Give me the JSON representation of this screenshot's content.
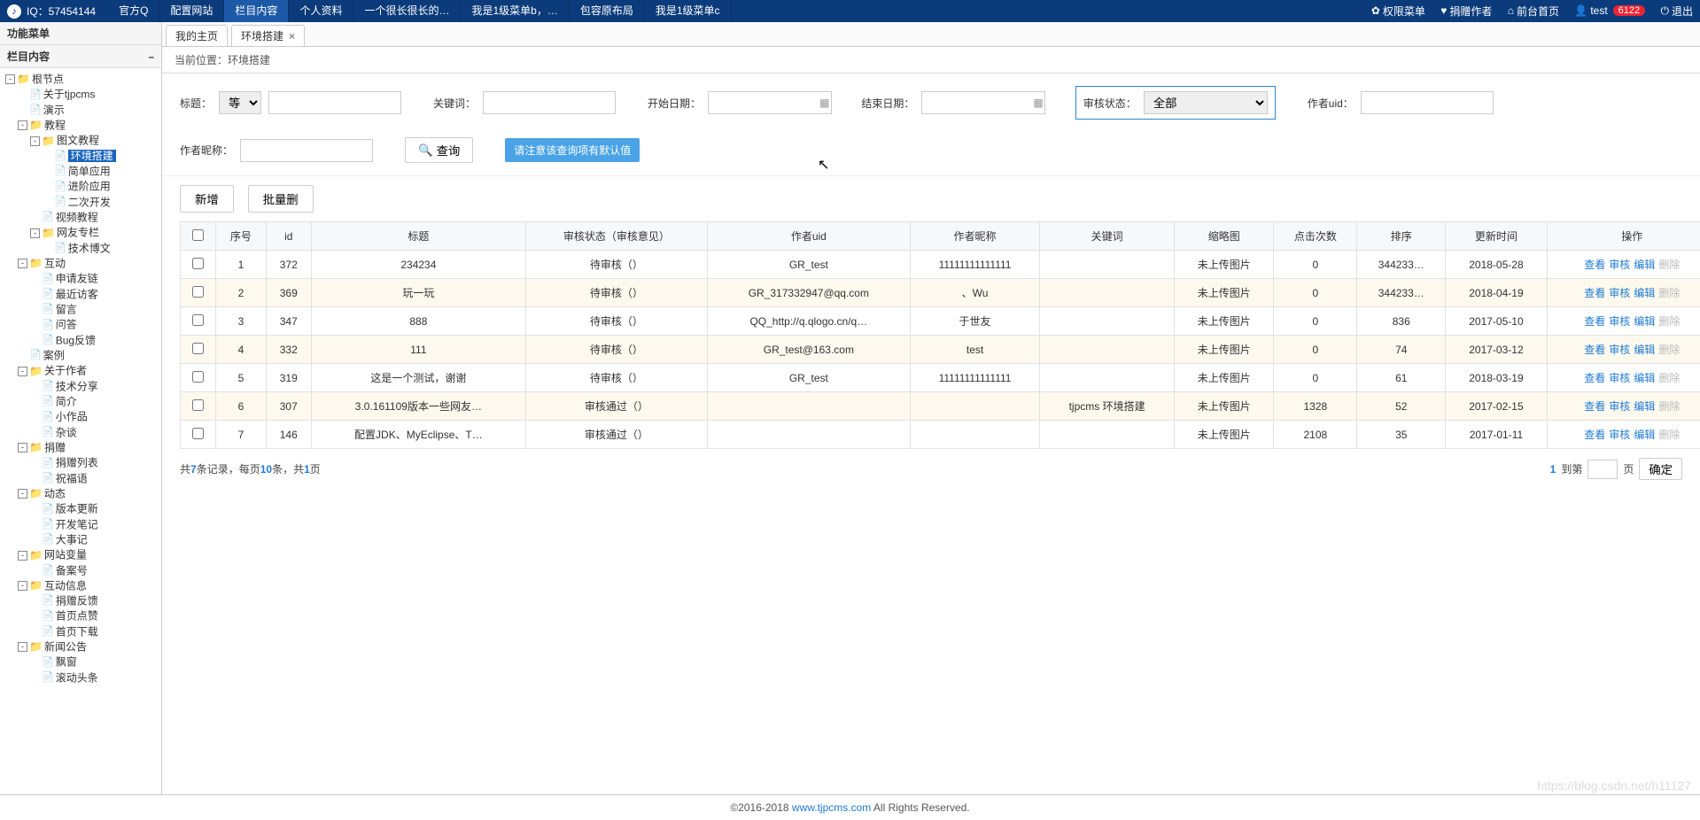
{
  "topbar": {
    "qq": "IQ：57454144",
    "nav": [
      "官方Q",
      "配置网站",
      "栏目内容",
      "个人资料",
      "一个很长很长的…",
      "我是1级菜单b，…",
      "包容原布局",
      "我是1级菜单c"
    ],
    "nav_active": 2,
    "right": {
      "perm": "权限菜单",
      "donate": "捐赠作者",
      "front": "前台首页",
      "user": "test",
      "badge": "6122",
      "logout": "退出"
    }
  },
  "sidebar": {
    "title1": "功能菜单",
    "title2": "栏目内容"
  },
  "tree": [
    {
      "t": "-",
      "f": 1,
      "l": "根节点",
      "c": [
        {
          "t": "",
          "f": 0,
          "l": "关于tjpcms"
        },
        {
          "t": "",
          "f": 0,
          "l": "演示"
        },
        {
          "t": "-",
          "f": 1,
          "l": "教程",
          "c": [
            {
              "t": "-",
              "f": 1,
              "l": "图文教程",
              "c": [
                {
                  "t": "",
                  "f": 0,
                  "l": "环境搭建",
                  "sel": 1
                },
                {
                  "t": "",
                  "f": 0,
                  "l": "简单应用"
                },
                {
                  "t": "",
                  "f": 0,
                  "l": "进阶应用"
                },
                {
                  "t": "",
                  "f": 0,
                  "l": "二次开发"
                }
              ]
            },
            {
              "t": "",
              "f": 0,
              "l": "视频教程"
            },
            {
              "t": "-",
              "f": 1,
              "l": "网友专栏",
              "c": [
                {
                  "t": "",
                  "f": 0,
                  "l": "技术博文"
                }
              ]
            }
          ]
        },
        {
          "t": "-",
          "f": 1,
          "l": "互动",
          "c": [
            {
              "t": "",
              "f": 0,
              "l": "申请友链"
            },
            {
              "t": "",
              "f": 0,
              "l": "最近访客"
            },
            {
              "t": "",
              "f": 0,
              "l": "留言"
            },
            {
              "t": "",
              "f": 0,
              "l": "问答"
            },
            {
              "t": "",
              "f": 0,
              "l": "Bug反馈"
            }
          ]
        },
        {
          "t": "",
          "f": 0,
          "l": "案例"
        },
        {
          "t": "-",
          "f": 1,
          "l": "关于作者",
          "c": [
            {
              "t": "",
              "f": 0,
              "l": "技术分享"
            },
            {
              "t": "",
              "f": 0,
              "l": "简介"
            },
            {
              "t": "",
              "f": 0,
              "l": "小作品"
            },
            {
              "t": "",
              "f": 0,
              "l": "杂谈"
            }
          ]
        },
        {
          "t": "-",
          "f": 1,
          "l": "捐赠",
          "c": [
            {
              "t": "",
              "f": 0,
              "l": "捐赠列表"
            },
            {
              "t": "",
              "f": 0,
              "l": "祝福语"
            }
          ]
        },
        {
          "t": "-",
          "f": 1,
          "l": "动态",
          "c": [
            {
              "t": "",
              "f": 0,
              "l": "版本更新"
            },
            {
              "t": "",
              "f": 0,
              "l": "开发笔记"
            },
            {
              "t": "",
              "f": 0,
              "l": "大事记"
            }
          ]
        },
        {
          "t": "-",
          "f": 1,
          "l": "网站变量",
          "c": [
            {
              "t": "",
              "f": 0,
              "l": "备案号"
            }
          ]
        },
        {
          "t": "-",
          "f": 1,
          "l": "互动信息",
          "c": [
            {
              "t": "",
              "f": 0,
              "l": "捐赠反馈"
            },
            {
              "t": "",
              "f": 0,
              "l": "首页点赞"
            },
            {
              "t": "",
              "f": 0,
              "l": "首页下载"
            }
          ]
        },
        {
          "t": "-",
          "f": 1,
          "l": "新闻公告",
          "c": [
            {
              "t": "",
              "f": 0,
              "l": "飘窗"
            },
            {
              "t": "",
              "f": 0,
              "l": "滚动头条"
            }
          ]
        }
      ]
    }
  ],
  "tabs": {
    "home": "我的主页",
    "cur": "环境搭建"
  },
  "bc": {
    "label": "当前位置：",
    "val": "环境搭建"
  },
  "filters": {
    "title": "标题：",
    "title_op": "等于",
    "keyword": "关键词：",
    "start": "开始日期：",
    "end": "结束日期：",
    "uid": "作者uid：",
    "nick": "作者昵称：",
    "status": "审核状态：",
    "status_val": "全部",
    "query": "查询",
    "tip": "请注意该查询项有默认值"
  },
  "buttons": {
    "add": "新增",
    "batch": "批量删"
  },
  "cols": [
    "序号",
    "id",
    "标题",
    "审核状态（审核意见）",
    "作者uid",
    "作者昵称",
    "关键词",
    "缩略图",
    "点击次数",
    "排序",
    "更新时间",
    "操作"
  ],
  "rows": [
    {
      "n": "1",
      "id": "372",
      "title": "234234",
      "st": "待审核（）",
      "uid": "GR_test",
      "nick": "11111111111111",
      "kw": "",
      "thumb": "未上传图片",
      "hits": "0",
      "sort": "344233…",
      "time": "2018-05-28"
    },
    {
      "n": "2",
      "id": "369",
      "title": "玩一玩",
      "st": "待审核（）",
      "uid": "GR_317332947@qq.com",
      "nick": "、Wu",
      "kw": "",
      "thumb": "未上传图片",
      "hits": "0",
      "sort": "344233…",
      "time": "2018-04-19"
    },
    {
      "n": "3",
      "id": "347",
      "title": "888",
      "st": "待审核（）",
      "uid": "QQ_http://q.qlogo.cn/q…",
      "nick": "于世友",
      "kw": "",
      "thumb": "未上传图片",
      "hits": "0",
      "sort": "836",
      "time": "2017-05-10"
    },
    {
      "n": "4",
      "id": "332",
      "title": "111",
      "st": "待审核（）",
      "uid": "GR_test@163.com",
      "nick": "test",
      "kw": "",
      "thumb": "未上传图片",
      "hits": "0",
      "sort": "74",
      "time": "2017-03-12"
    },
    {
      "n": "5",
      "id": "319",
      "title": "这是一个测试，谢谢",
      "st": "待审核（）",
      "uid": "GR_test",
      "nick": "11111111111111",
      "kw": "",
      "thumb": "未上传图片",
      "hits": "0",
      "sort": "61",
      "time": "2018-03-19"
    },
    {
      "n": "6",
      "id": "307",
      "title": "3.0.161109版本一些网友…",
      "st": "审核通过（）",
      "uid": "",
      "nick": "",
      "kw": "tjpcms 环境搭建",
      "thumb": "未上传图片",
      "hits": "1328",
      "sort": "52",
      "time": "2017-02-15"
    },
    {
      "n": "7",
      "id": "146",
      "title": "配置JDK、MyEclipse、T…",
      "st": "审核通过（）",
      "uid": "",
      "nick": "",
      "kw": "",
      "thumb": "未上传图片",
      "hits": "2108",
      "sort": "35",
      "time": "2017-01-11"
    }
  ],
  "actions": {
    "view": "查看",
    "audit": "审核",
    "edit": "编辑",
    "del": "删除"
  },
  "pager": {
    "p1": "共",
    "total": "7",
    "p2": "条记录，每页",
    "per": "10",
    "p3": "条，共",
    "pages": "1",
    "p4": "页",
    "cur": "1",
    "goto1": "到第",
    "goto2": "页",
    "ok": "确定"
  },
  "footer": {
    "c": "©2016-2018 ",
    "link": "www.tjpcms.com",
    "r": " All Rights Reserved."
  },
  "watermark": "https://blog.csdn.net/h11127"
}
